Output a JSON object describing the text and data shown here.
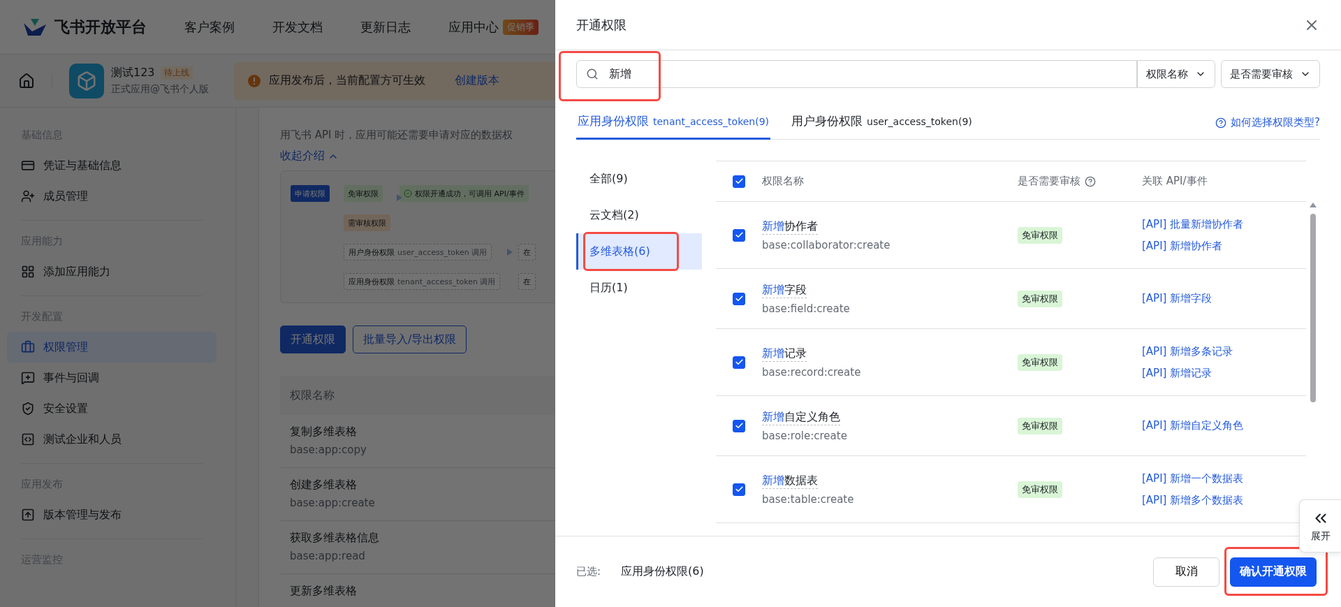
{
  "nav": {
    "logo_text": "飞书开放平台",
    "items": [
      {
        "label": "客户案例"
      },
      {
        "label": "开发文档"
      },
      {
        "label": "更新日志"
      },
      {
        "label": "应用中心",
        "badge": "促销季"
      }
    ]
  },
  "app": {
    "name": "测试123",
    "status": "待上线",
    "subtitle": "正式应用@飞书个人版"
  },
  "notice": {
    "text": "应用发布后，当前配置方可生效",
    "action": "创建版本"
  },
  "sidebar": {
    "sections": [
      {
        "title": "基础信息",
        "items": [
          {
            "label": "凭证与基础信息",
            "selected": false
          },
          {
            "label": "成员管理",
            "selected": false
          }
        ]
      },
      {
        "title": "应用能力",
        "items": [
          {
            "label": "添加应用能力",
            "selected": false
          }
        ]
      },
      {
        "title": "开发配置",
        "items": [
          {
            "label": "权限管理",
            "selected": true
          },
          {
            "label": "事件与回调",
            "selected": false
          },
          {
            "label": "安全设置",
            "selected": false
          },
          {
            "label": "测试企业和人员",
            "selected": false
          }
        ]
      },
      {
        "title": "应用发布",
        "items": [
          {
            "label": "版本管理与发布",
            "selected": false
          }
        ]
      },
      {
        "title": "运营监控"
      }
    ]
  },
  "intro": {
    "text": "用飞书 API 时，应用可能还需要申请对应的数据权",
    "toggle": "收起介绍"
  },
  "diagram": {
    "nodes": [
      {
        "kind": "start",
        "label": "申请权限"
      },
      {
        "kind": "free",
        "label": "免审权限"
      },
      {
        "kind": "success",
        "label": "权限开通成功，可调用 API/事件"
      },
      {
        "kind": "review",
        "label": "需审核权限"
      },
      {
        "kind": "path",
        "label": "用户身份权限",
        "note": "user_access_token 调用"
      },
      {
        "kind": "path",
        "label": "应用身份权限",
        "note": "tenant_access_token 调用"
      },
      {
        "kind": "cut",
        "label": "在"
      },
      {
        "kind": "cut",
        "label": "在"
      }
    ]
  },
  "actions": [
    {
      "kind": "primary",
      "label": "开通权限"
    },
    {
      "kind": "outline",
      "label": "批量导入/导出权限"
    }
  ],
  "table": {
    "columns": [
      "权限名称"
    ],
    "rows": [
      {
        "name": "复制多维表格",
        "code": "base:app:copy"
      },
      {
        "name": "创建多维表格",
        "code": "base:app:create"
      },
      {
        "name": "获取多维表格信息",
        "code": "base:app:read"
      },
      {
        "name": "更新多维表格"
      }
    ]
  },
  "modal": {
    "title": "开通权限",
    "search": {
      "value": "新增",
      "highlighted": true
    },
    "filters": [
      "权限名称",
      "是否需要审核"
    ],
    "tabs": [
      {
        "label": "应用身份权限",
        "note": "tenant_access_token(9)",
        "selected": true
      },
      {
        "label": "用户身份权限",
        "note": "user_access_token(9)",
        "selected": false
      }
    ],
    "help": "如何选择权限类型?",
    "categories": [
      {
        "label": "全部(9)",
        "selected": false,
        "highlighted": false
      },
      {
        "label": "云文档(2)",
        "selected": false,
        "highlighted": false
      },
      {
        "label": "多维表格(6)",
        "selected": true,
        "highlighted": true
      },
      {
        "label": "日历(1)",
        "selected": false,
        "highlighted": false
      }
    ],
    "all_checked": true,
    "columns": [
      "权限名称",
      "是否需要审核",
      "关联 API/事件"
    ],
    "rows": [
      {
        "checked": true,
        "match": "新增",
        "rest": "协作者",
        "code": "base:collaborator:create",
        "badge": "免审权限",
        "apis": [
          "[API] 批量新增协作者",
          "[API] 新增协作者"
        ]
      },
      {
        "checked": true,
        "match": "新增",
        "rest": "字段",
        "code": "base:field:create",
        "badge": "免审权限",
        "apis": [
          "[API] 新增字段"
        ]
      },
      {
        "checked": true,
        "match": "新增",
        "rest": "记录",
        "code": "base:record:create",
        "badge": "免审权限",
        "apis": [
          "[API] 新增多条记录",
          "[API] 新增记录"
        ]
      },
      {
        "checked": true,
        "match": "新增",
        "rest": "自定义角色",
        "code": "base:role:create",
        "badge": "免审权限",
        "apis": [
          "[API] 新增自定义角色"
        ]
      },
      {
        "checked": true,
        "match": "新增",
        "rest": "数据表",
        "code": "base:table:create",
        "badge": "免审权限",
        "apis": [
          "[API] 新增一个数据表",
          "[API] 新增多个数据表"
        ]
      }
    ],
    "footer": {
      "label": "已选:",
      "value": "应用身份权限(6)",
      "cancel": "取消",
      "confirm": {
        "label": "确认开通权限",
        "highlighted": true
      }
    }
  },
  "side_tab": {
    "label": "展开"
  }
}
